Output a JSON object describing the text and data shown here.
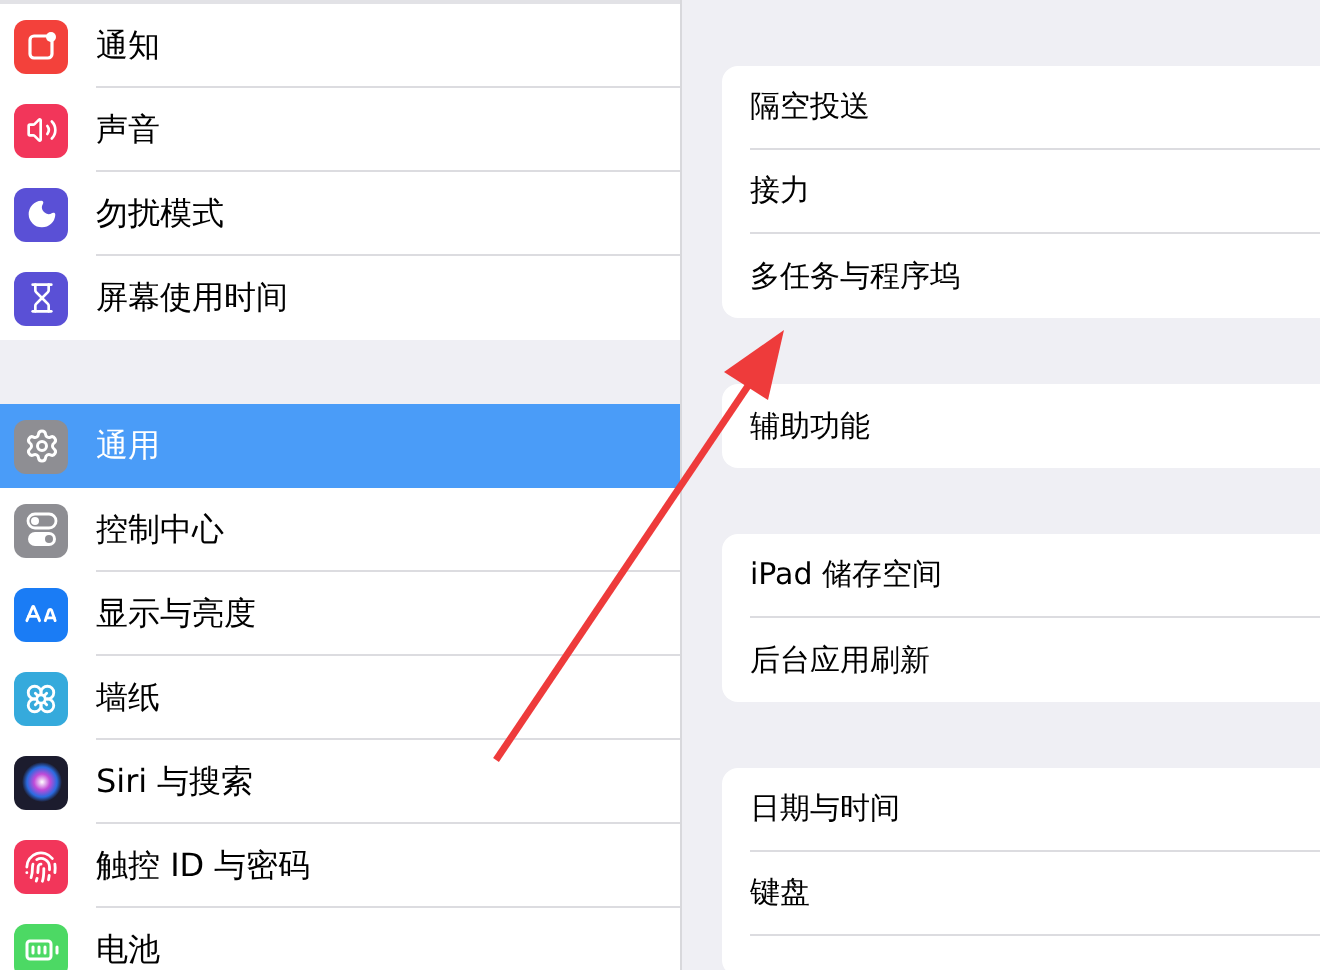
{
  "sidebar": {
    "groups": [
      {
        "items": [
          {
            "label": "通知",
            "color": "#f3413b",
            "selected": false
          },
          {
            "label": "声音",
            "color": "#f2365a",
            "selected": false
          },
          {
            "label": "勿扰模式",
            "color": "#5a50d6",
            "selected": false
          },
          {
            "label": "屏幕使用时间",
            "color": "#5a50d6",
            "selected": false
          }
        ]
      },
      {
        "items": [
          {
            "label": "通用",
            "color": "#8e8e93",
            "selected": true
          },
          {
            "label": "控制中心",
            "color": "#8e8e93",
            "selected": false
          },
          {
            "label": "显示与亮度",
            "color": "#1a7cf5",
            "selected": false
          },
          {
            "label": "墙纸",
            "color": "#35aadc",
            "selected": false
          },
          {
            "label": "Siri 与搜索",
            "color": "#1c1c2e",
            "selected": false
          },
          {
            "label": "触控 ID 与密码",
            "color": "#f2365a",
            "selected": false
          },
          {
            "label": "电池",
            "color": "#4cd964",
            "selected": false
          }
        ]
      }
    ]
  },
  "detail": {
    "groups": [
      {
        "items": [
          "隔空投送",
          "接力",
          "多任务与程序坞"
        ]
      },
      {
        "items": [
          "辅助功能"
        ]
      },
      {
        "items": [
          "iPad 储存空间",
          "后台应用刷新"
        ]
      },
      {
        "items": [
          "日期与时间",
          "键盘"
        ]
      }
    ]
  }
}
